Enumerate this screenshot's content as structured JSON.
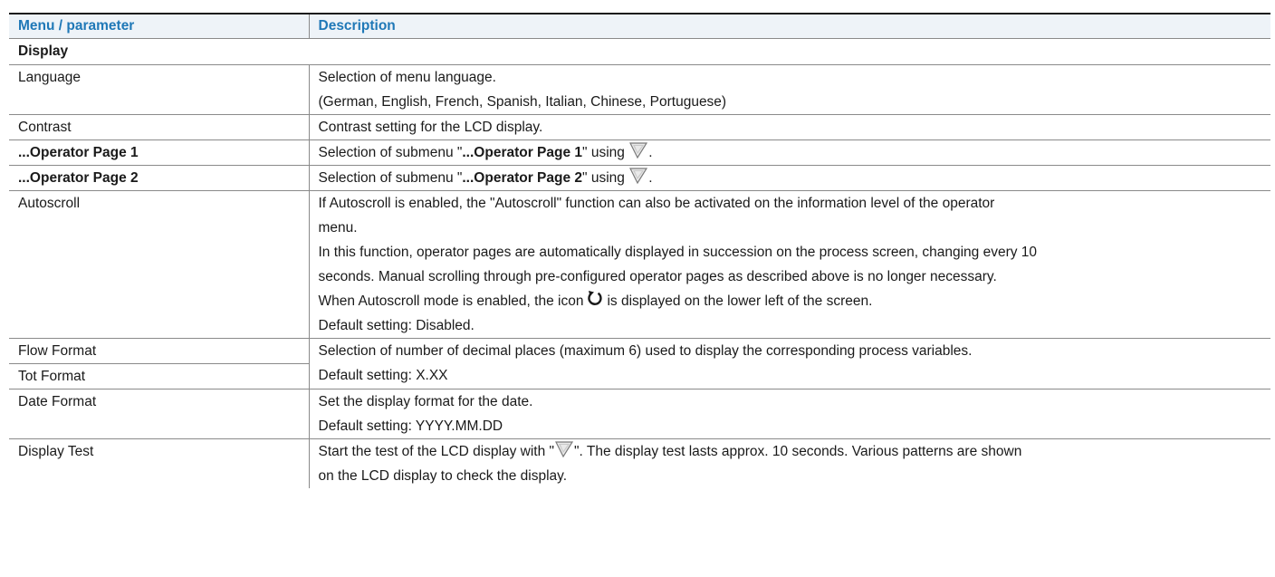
{
  "header": {
    "col1": "Menu / parameter",
    "col2": "Description"
  },
  "section_title": "Display",
  "rows": {
    "language": {
      "param": "Language",
      "line1": "Selection of menu language.",
      "line2": "(German, English, French, Spanish, Italian, Chinese, Portuguese)"
    },
    "contrast": {
      "param": "Contrast",
      "line1": "Contrast setting for the LCD display."
    },
    "op_page1": {
      "param": "...Operator Page 1",
      "pre": "Selection of submenu \"",
      "bold": "...Operator Page 1",
      "mid": "\" using ",
      "post": "."
    },
    "op_page2": {
      "param": "...Operator Page 2",
      "pre": "Selection of submenu \"",
      "bold": "...Operator Page 2",
      "mid": "\" using ",
      "post": "."
    },
    "autoscroll": {
      "param": "Autoscroll",
      "line1": "If Autoscroll is enabled, the \"Autoscroll\" function can also be activated on the information level of the operator",
      "line2": "menu.",
      "line3": "In this function, operator pages are automatically displayed in succession on the process screen, changing every 10",
      "line4": "seconds. Manual scrolling through pre-configured operator pages as described above is no longer necessary.",
      "line5_pre": "When Autoscroll mode is enabled, the icon",
      "line5_post": "is displayed on the lower left of the screen.",
      "line6": "Default setting: Disabled."
    },
    "flow_tot": {
      "param1": "Flow Format",
      "param2": "Tot Format",
      "line1": "Selection of number of decimal places (maximum 6) used to display the corresponding process variables.",
      "line2": "Default setting: X.XX"
    },
    "date_format": {
      "param": "Date Format",
      "line1": "Set the display format for the date.",
      "line2": "Default setting: YYYY.MM.DD"
    },
    "display_test": {
      "param": "Display Test",
      "line1_pre": "Start the test of the LCD display with \"",
      "line1_post": "\". The display test lasts approx. 10 seconds. Various patterns are shown",
      "line2": "on the LCD display to check the display."
    }
  },
  "icons": {
    "enter_button": "enter-button-icon",
    "autoscroll": "autoscroll-cycle-icon"
  },
  "colors": {
    "header_text": "#1f78b7",
    "header_bg": "#eef3f8",
    "rule": "#8a8a8a"
  }
}
